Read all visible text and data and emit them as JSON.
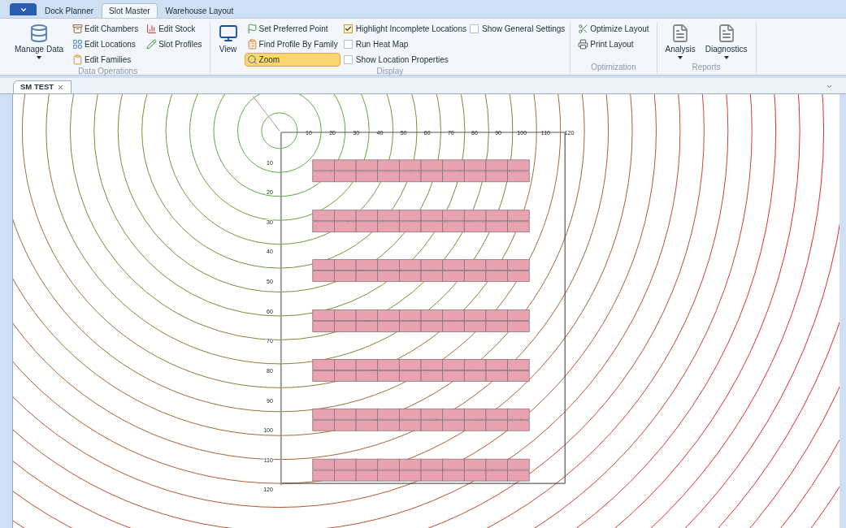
{
  "tabs": [
    {
      "label": "Dock Planner",
      "selected": false
    },
    {
      "label": "Slot Master",
      "selected": true
    },
    {
      "label": "Warehouse Layout",
      "selected": false
    }
  ],
  "ribbon": {
    "groups": [
      {
        "title": "Data Operations",
        "columns": [
          [
            {
              "kind": "large",
              "label": "Manage Data",
              "dropdown": true
            }
          ],
          [
            {
              "kind": "button",
              "label": "Edit Chambers",
              "selected": false
            },
            {
              "kind": "button",
              "label": "Edit Locations",
              "selected": false
            },
            {
              "kind": "button",
              "label": "Edit Families",
              "selected": false
            }
          ],
          [
            {
              "kind": "button",
              "label": "Edit Stock",
              "selected": false
            },
            {
              "kind": "button",
              "label": "Slot Profiles",
              "selected": false
            }
          ]
        ]
      },
      {
        "title": "Display",
        "columns": [
          [
            {
              "kind": "large",
              "label": "View",
              "dropdown": false
            }
          ],
          [
            {
              "kind": "button",
              "label": "Set Preferred Point",
              "selected": false
            },
            {
              "kind": "button",
              "label": "Find Profile By Family",
              "selected": false
            },
            {
              "kind": "button",
              "label": "Zoom",
              "selected": true
            }
          ],
          [
            {
              "kind": "checkbox",
              "label": "Highlight Incomplete Locations",
              "checked": true
            },
            {
              "kind": "checkbox",
              "label": "Run Heat Map",
              "checked": false
            },
            {
              "kind": "checkbox",
              "label": "Show Location Properties",
              "checked": false
            }
          ],
          [
            {
              "kind": "checkbox",
              "label": "Show General Settings",
              "checked": false
            }
          ]
        ]
      },
      {
        "title": "Optimization",
        "columns": [
          [
            {
              "kind": "button",
              "label": "Optimize Layout",
              "selected": false
            },
            {
              "kind": "button",
              "label": "Print Layout",
              "selected": false
            }
          ]
        ]
      },
      {
        "title": "Reports",
        "columns": [
          [
            {
              "kind": "large",
              "label": "Analysis",
              "dropdown": true
            }
          ],
          [
            {
              "kind": "large",
              "label": "Diagnostics",
              "dropdown": true
            }
          ]
        ]
      }
    ]
  },
  "documents": [
    {
      "label": "SM TEST",
      "selected": true
    }
  ],
  "layout_view": {
    "x_ticks": [
      "10",
      "20",
      "30",
      "40",
      "50",
      "60",
      "70",
      "80",
      "90",
      "100",
      "110",
      "120"
    ],
    "y_ticks": [
      "10",
      "20",
      "30",
      "40",
      "50",
      "60",
      "70",
      "80",
      "90",
      "100",
      "110",
      "120"
    ]
  }
}
